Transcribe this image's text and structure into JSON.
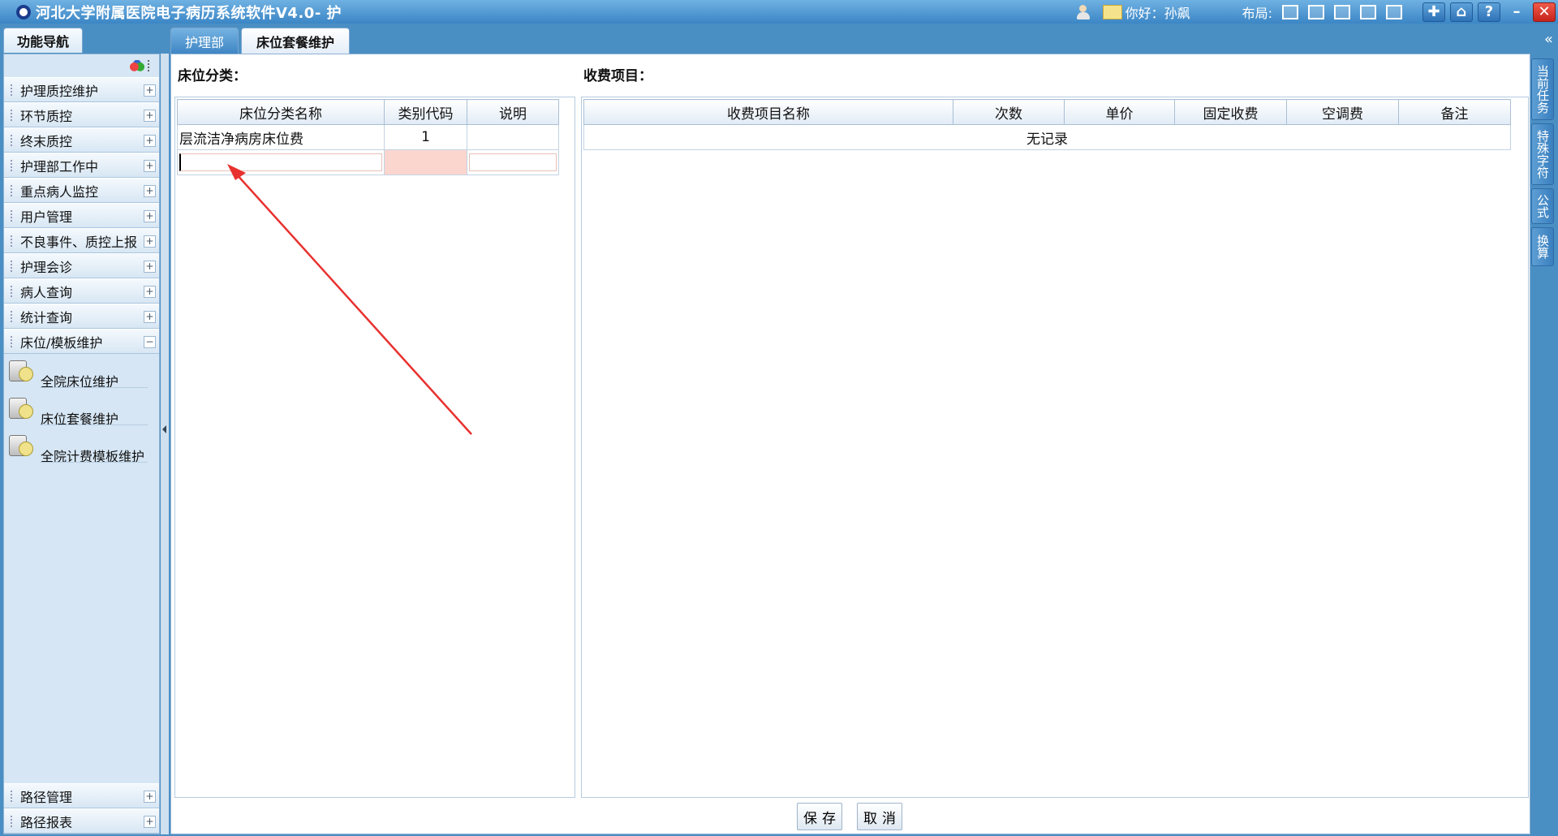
{
  "window": {
    "title": "河北大学附属医院电子病历系统软件V4.0- 护",
    "greeting": "你好：孙飙",
    "layout_label": "布局:",
    "help_glyph": "?",
    "minimize_glyph": "–",
    "close_glyph": "✕"
  },
  "nav": {
    "tab_label": "功能导航",
    "items": [
      {
        "label": "护理质控维护",
        "state": "+"
      },
      {
        "label": "环节质控",
        "state": "+"
      },
      {
        "label": "终末质控",
        "state": "+"
      },
      {
        "label": "护理部工作中",
        "state": "+"
      },
      {
        "label": "重点病人监控",
        "state": "+"
      },
      {
        "label": "用户管理",
        "state": "+"
      },
      {
        "label": "不良事件、质控上报",
        "state": "+"
      },
      {
        "label": "护理会诊",
        "state": "+"
      },
      {
        "label": "病人查询",
        "state": "+"
      },
      {
        "label": "统计查询",
        "state": "+"
      },
      {
        "label": "床位/模板维护",
        "state": "−"
      }
    ],
    "sub_items": [
      {
        "label": "全院床位维护"
      },
      {
        "label": "床位套餐维护"
      },
      {
        "label": "全院计费模板维护"
      }
    ],
    "bottom_items": [
      {
        "label": "路径管理",
        "state": "+"
      },
      {
        "label": "路径报表",
        "state": "+"
      }
    ]
  },
  "tabs": [
    {
      "label": "护理部",
      "active": false
    },
    {
      "label": "床位套餐维护",
      "active": true
    }
  ],
  "collapse_glyph": "«",
  "bed_category": {
    "title": "床位分类：",
    "columns": [
      "床位分类名称",
      "类别代码",
      "说明"
    ],
    "rows": [
      {
        "name": "层流洁净病房床位费",
        "code": "1",
        "note": ""
      }
    ],
    "new_row": {
      "name": "",
      "code": "",
      "note": ""
    }
  },
  "charge_items": {
    "title": "收费项目：",
    "columns": [
      "收费项目名称",
      "次数",
      "单价",
      "固定收费",
      "空调费",
      "备注"
    ],
    "empty_text": "无记录"
  },
  "buttons": {
    "save": "保存",
    "cancel": "取消"
  },
  "side_tabs": [
    {
      "label": "当前任务"
    },
    {
      "label": "特殊字符"
    },
    {
      "label": "公式"
    },
    {
      "label": "换算"
    }
  ],
  "colors": {
    "titlebar": "#3b86c6",
    "nav_bg": "#d6e6f4",
    "edit_cell": "#fbd6cf",
    "annotation_arrow": "#e8312f"
  }
}
